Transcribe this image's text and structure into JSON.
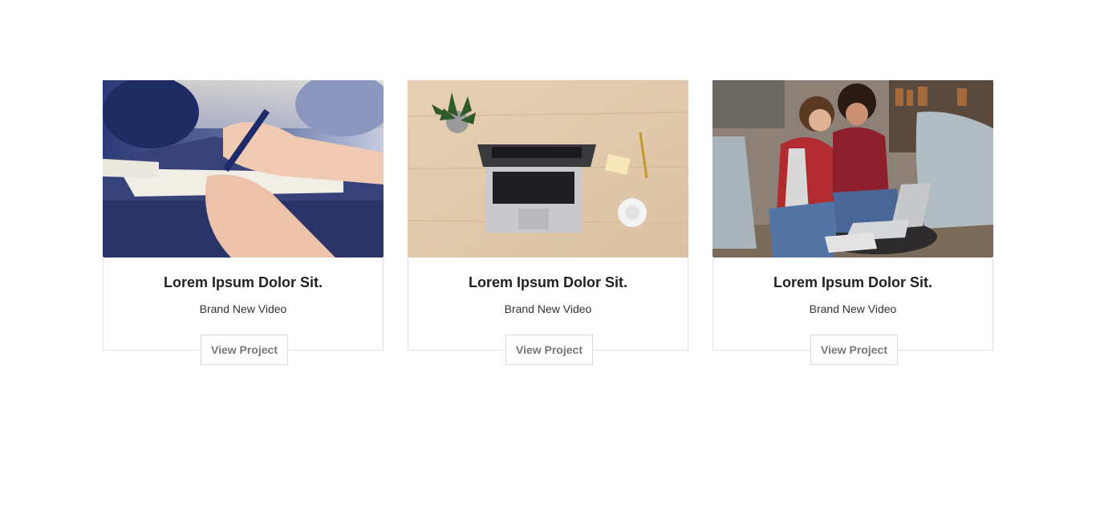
{
  "cards": [
    {
      "image": "people-writing-notes-photo",
      "title": "Lorem Ipsum Dolor Sit.",
      "subtitle": "Brand New Video",
      "button_label": "View Project"
    },
    {
      "image": "laptop-on-wooden-desk-photo",
      "title": "Lorem Ipsum Dolor Sit.",
      "subtitle": "Brand New Video",
      "button_label": "View Project"
    },
    {
      "image": "two-women-with-laptop-photo",
      "title": "Lorem Ipsum Dolor Sit.",
      "subtitle": "Brand New Video",
      "button_label": "View Project"
    }
  ],
  "colors": {
    "title": "#222222",
    "subtitle": "#333333",
    "button_text": "#777777",
    "border": "#e2e2e2"
  }
}
